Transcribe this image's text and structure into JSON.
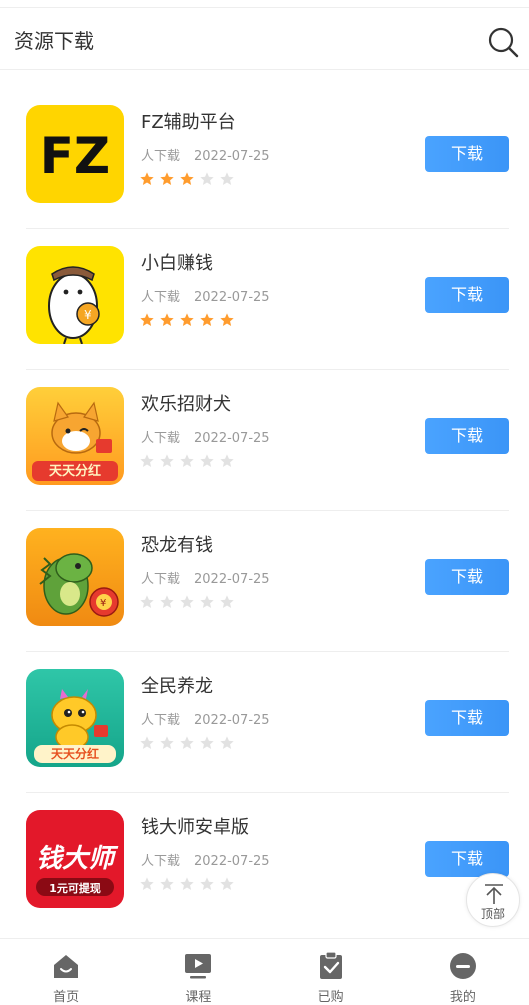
{
  "header": {
    "title": "资源下载",
    "search_icon": "search-icon"
  },
  "accent": "#3b95f7",
  "star_on_color": "#ff9c2e",
  "star_off_color": "#e2e2e2",
  "items": [
    {
      "name": "FZ辅助平台",
      "downloads_label": "人下载",
      "date": "2022-07-25",
      "rating": 3,
      "button": "下载",
      "icon_text": "FZ"
    },
    {
      "name": "小白赚钱",
      "downloads_label": "人下载",
      "date": "2022-07-25",
      "rating": 5,
      "button": "下载"
    },
    {
      "name": "欢乐招财犬",
      "downloads_label": "人下载",
      "date": "2022-07-25",
      "rating": 0,
      "button": "下载",
      "icon_text": "天天分红"
    },
    {
      "name": "恐龙有钱",
      "downloads_label": "人下载",
      "date": "2022-07-25",
      "rating": 0,
      "button": "下载"
    },
    {
      "name": "全民养龙",
      "downloads_label": "人下载",
      "date": "2022-07-25",
      "rating": 0,
      "button": "下载",
      "icon_text": "天天分红"
    },
    {
      "name": "钱大师安卓版",
      "downloads_label": "人下载",
      "date": "2022-07-25",
      "rating": 0,
      "button": "下载",
      "icon_text": "钱大师",
      "icon_subtext": "1元可提现"
    }
  ],
  "to_top": {
    "label": "顶部"
  },
  "tabbar": [
    {
      "label": "首页",
      "icon": "home-icon"
    },
    {
      "label": "课程",
      "icon": "video-icon"
    },
    {
      "label": "已购",
      "icon": "clipboard-check-icon"
    },
    {
      "label": "我的",
      "icon": "profile-icon"
    }
  ]
}
